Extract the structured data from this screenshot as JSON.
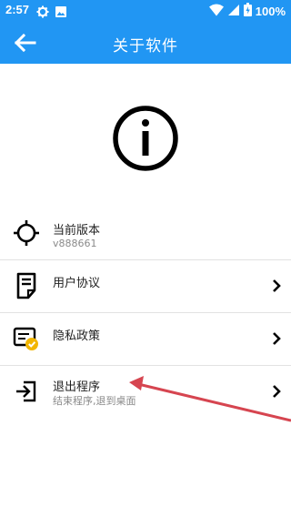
{
  "status_bar": {
    "time": "2:57",
    "battery": "100%",
    "icons": [
      "gear-icon",
      "image-icon",
      "wifi-icon",
      "signal-icon",
      "battery-icon"
    ]
  },
  "app_bar": {
    "title": "关于软件",
    "back_icon": "arrow-left-icon"
  },
  "header_icon": "info-icon",
  "list": {
    "items": [
      {
        "title": "当前版本",
        "subtitle": "v888661",
        "icon": "crosshair-icon",
        "chevron": false
      },
      {
        "title": "用户协议",
        "subtitle": "",
        "icon": "document-icon",
        "chevron": true
      },
      {
        "title": "隐私政策",
        "subtitle": "",
        "icon": "privacy-badge-icon",
        "chevron": true
      },
      {
        "title": "退出程序",
        "subtitle": "结束程序,退到桌面",
        "icon": "exit-icon",
        "chevron": true
      }
    ]
  },
  "colors": {
    "primary": "#2196F3",
    "annotation_arrow": "#D64550"
  }
}
